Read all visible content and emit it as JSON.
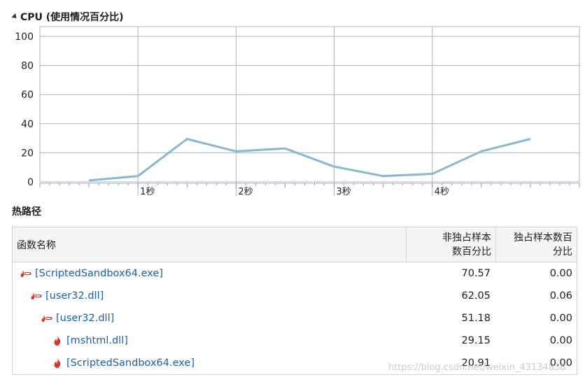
{
  "cpu_section": {
    "title": "CPU (使用情况百分比)"
  },
  "chart_data": {
    "type": "line",
    "title": "CPU (使用情况百分比)",
    "xlabel": "",
    "ylabel": "",
    "y_ticks": [
      "100",
      "80",
      "60",
      "40",
      "20",
      "0"
    ],
    "ylim": [
      0,
      100
    ],
    "x_ticks": [
      "1秒",
      "2秒",
      "3秒",
      "4秒"
    ],
    "xlim": [
      -1.0,
      4.5
    ],
    "grid": true,
    "series": [
      {
        "x": [
          -0.5,
          0.0,
          0.5,
          1.0,
          1.5,
          2.0,
          2.5,
          3.0,
          3.5,
          4.0
        ],
        "y": [
          1,
          4,
          29.5,
          21,
          23,
          10.5,
          4,
          5.5,
          21,
          29.5
        ],
        "color": "#88b8d0"
      }
    ]
  },
  "hotpath": {
    "title": "热路径",
    "columns": {
      "name": "函数名称",
      "inclusive": "非独占样本数百分比",
      "exclusive": "独占样本数百分比"
    },
    "rows": [
      {
        "name": "[ScriptedSandbox64.exe]",
        "inclusive": "70.57",
        "exclusive": "0.00",
        "icon": "hot-path-arrow-icon"
      },
      {
        "name": "[user32.dll]",
        "inclusive": "62.05",
        "exclusive": "0.06",
        "icon": "hot-path-arrow-icon"
      },
      {
        "name": "[user32.dll]",
        "inclusive": "51.18",
        "exclusive": "0.00",
        "icon": "hot-path-arrow-icon"
      },
      {
        "name": "[mshtml.dll]",
        "inclusive": "29.15",
        "exclusive": "0.00",
        "icon": "flame-icon"
      },
      {
        "name": "[ScriptedSandbox64.exe]",
        "inclusive": "20.91",
        "exclusive": "0.00",
        "icon": "flame-icon"
      }
    ]
  },
  "watermark": "https://blog.csdn.net/weixin_43134838",
  "colors": {
    "line": "#88b8d0",
    "link": "#1a5fb4",
    "grid": "#a8b4c4",
    "flame": "#d9302b"
  }
}
